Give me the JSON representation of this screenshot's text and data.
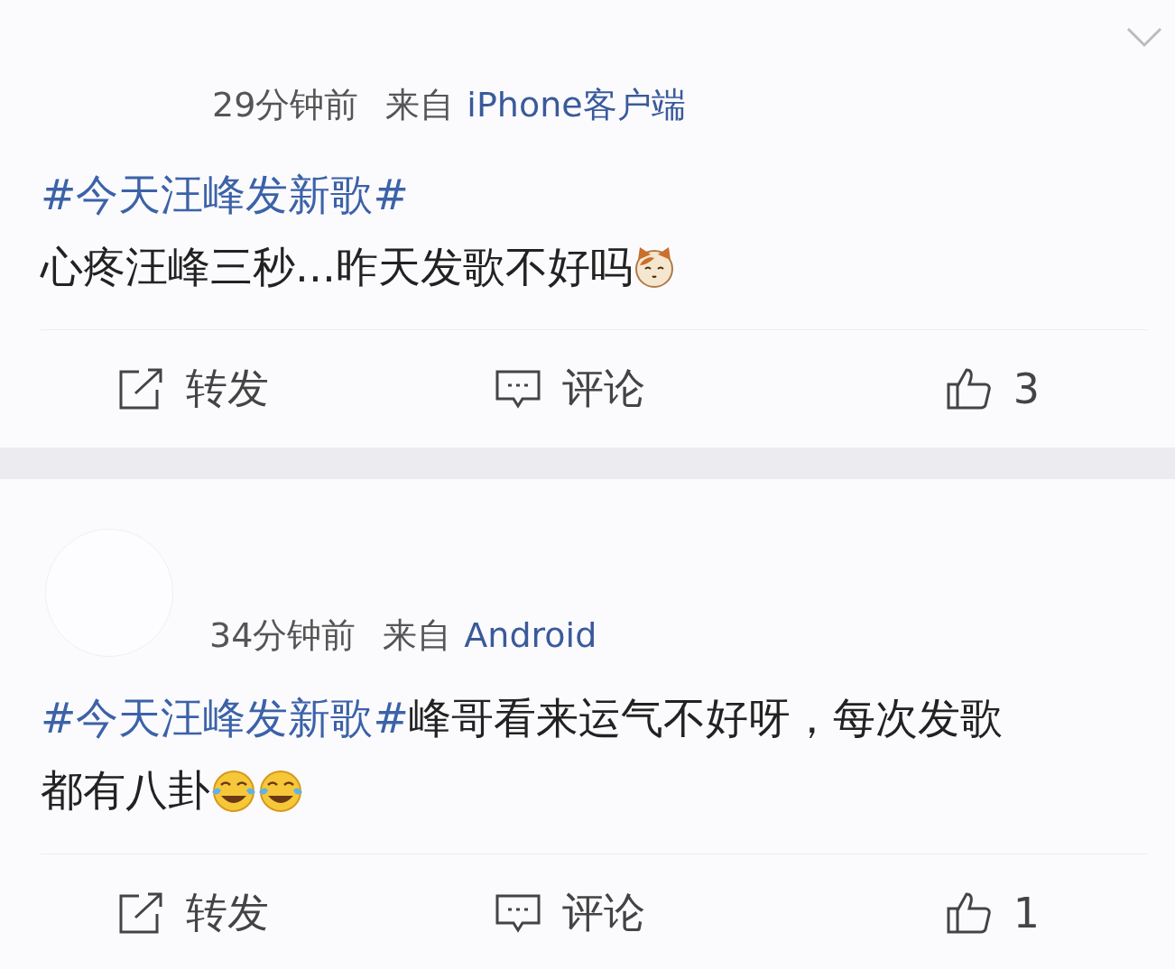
{
  "posts": [
    {
      "menu_chevron": true,
      "avatar": false,
      "meta": {
        "time": "29分钟前",
        "source_prefix": "来自",
        "source": "iPhone客户端"
      },
      "hashtag": "#今天汪峰发新歌#",
      "hashtag_own_line": true,
      "text": "心疼汪峰三秒...昨天发歌不好吗",
      "emojis": [
        {
          "kind": "cat"
        }
      ],
      "actions": [
        {
          "kind": "repost",
          "label": "转发"
        },
        {
          "kind": "comment",
          "label": "评论"
        },
        {
          "kind": "like",
          "label": "3"
        }
      ]
    },
    {
      "menu_chevron": false,
      "avatar": true,
      "meta": {
        "time": "34分钟前",
        "source_prefix": "来自",
        "source": "Android"
      },
      "hashtag": "#今天汪峰发新歌#",
      "hashtag_own_line": false,
      "text": "峰哥看来运气不好呀，每次发歌都有八卦",
      "emojis": [
        {
          "kind": "laugh-cry"
        },
        {
          "kind": "laugh-cry"
        }
      ],
      "actions": [
        {
          "kind": "repost",
          "label": "转发"
        },
        {
          "kind": "comment",
          "label": "评论"
        },
        {
          "kind": "like",
          "label": "1"
        }
      ]
    }
  ]
}
